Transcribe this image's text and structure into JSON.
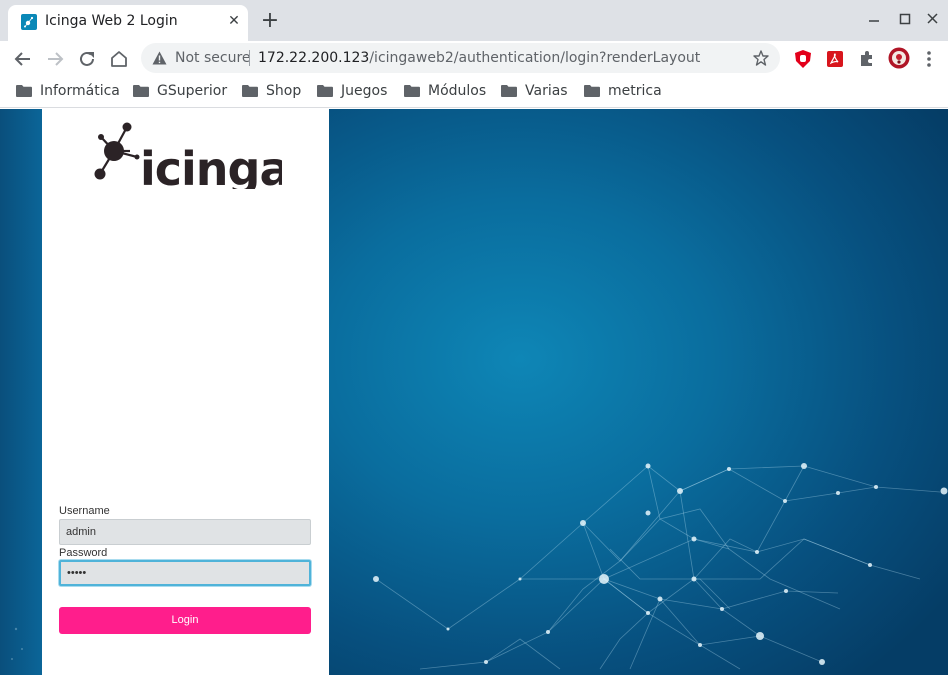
{
  "browser": {
    "tab": {
      "title": "Icinga Web 2 Login",
      "close_glyph": "✕",
      "favicon": "icinga-favicon"
    },
    "new_tab_glyph": "+",
    "window_controls": [
      "minimize-icon",
      "maximize-icon",
      "close-icon"
    ],
    "omnibox": {
      "security_label": "Not secure",
      "url_host": "172.22.200.123",
      "url_path": "/icingaweb2/authentication/login?renderLayout"
    },
    "extensions": [
      "ublock-icon",
      "pdf-icon",
      "puzzle-icon",
      "profile-avatar"
    ],
    "bookmarks": [
      {
        "label": "Informática"
      },
      {
        "label": "GSuperior"
      },
      {
        "label": "Shop"
      },
      {
        "label": "Juegos"
      },
      {
        "label": "Módulos"
      },
      {
        "label": "Varias"
      },
      {
        "label": "metrica"
      }
    ]
  },
  "login": {
    "logo_text": "icinga",
    "username_label": "Username",
    "username_value": "admin",
    "password_label": "Password",
    "password_value": "•••••",
    "login_button": "Login"
  },
  "colors": {
    "accent": "#ff1e8c",
    "focus_ring": "#4fb3d9",
    "background_blue": "#0a6d9e"
  }
}
